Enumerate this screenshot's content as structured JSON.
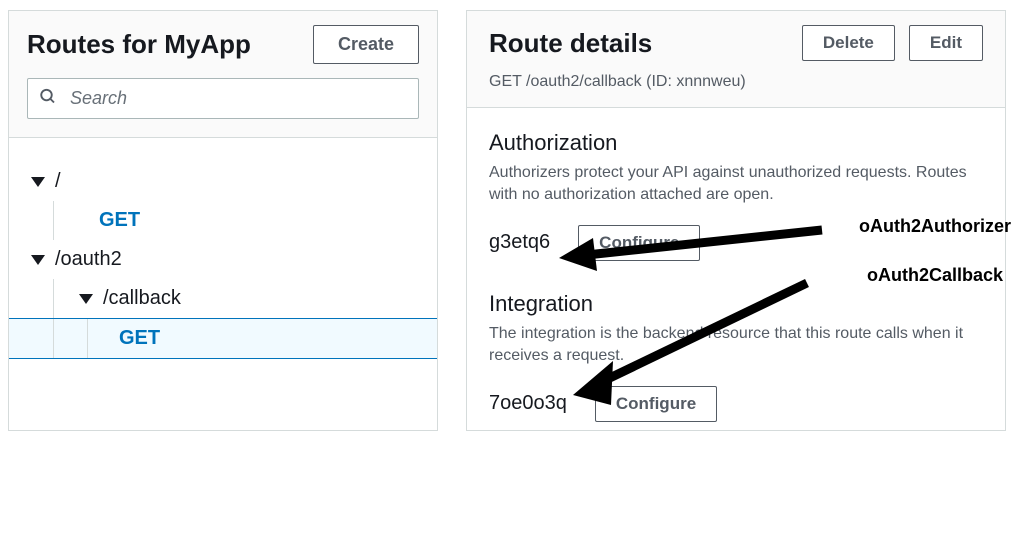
{
  "left": {
    "title": "Routes for MyApp",
    "create_label": "Create",
    "search_placeholder": "Search",
    "tree": {
      "root": "/",
      "root_method": "GET",
      "oauth2": "/oauth2",
      "callback": "/callback",
      "callback_method": "GET"
    }
  },
  "right": {
    "title": "Route details",
    "delete_label": "Delete",
    "edit_label": "Edit",
    "subtitle": "GET /oauth2/callback (ID: xnnnweu)",
    "authorization": {
      "heading": "Authorization",
      "desc": "Authorizers protect your API against unauthorized requests. Routes with no authorization attached are open.",
      "value": "g3etq6",
      "configure_label": "Configure",
      "annotation": "oAuth2Authorizer"
    },
    "integration": {
      "heading": "Integration",
      "desc": "The integration is the backend resource that this route calls when it receives a request.",
      "value": "7oe0o3q",
      "configure_label": "Configure",
      "annotation": "oAuth2Callback"
    }
  }
}
